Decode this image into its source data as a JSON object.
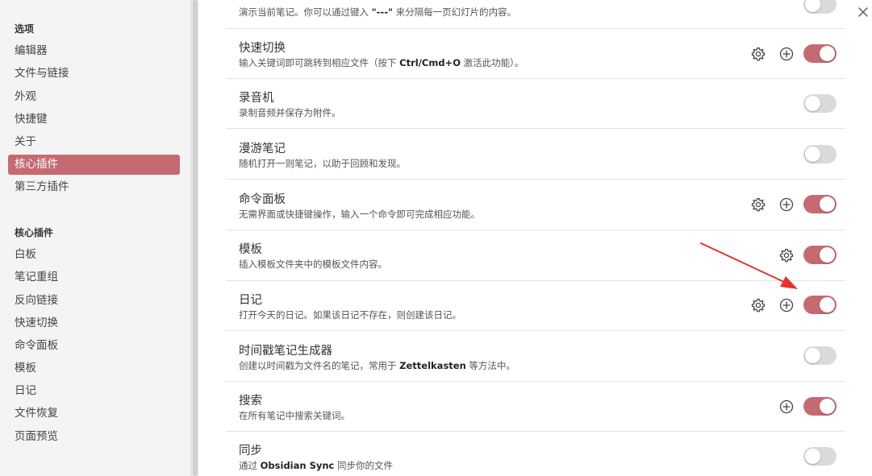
{
  "sidebar": {
    "options_heading": "选项",
    "options": [
      "编辑器",
      "文件与链接",
      "外观",
      "快捷键",
      "关于",
      "核心插件",
      "第三方插件"
    ],
    "active_index": 5,
    "core_heading": "核心插件",
    "core_items": [
      "白板",
      "笔记重组",
      "反向链接",
      "快速切换",
      "命令面板",
      "模板",
      "日记",
      "文件恢复",
      "页面预览"
    ]
  },
  "plugins": {
    "slides": {
      "desc_prefix": "演示当前笔记。你可以通过键入 ",
      "desc_bold": "\"---\"",
      "desc_suffix": " 来分隔每一页幻灯片的内容。",
      "enabled": false
    },
    "switcher": {
      "name": "快速切换",
      "desc_prefix": "输入关键词即可跳转到相应文件（按下 ",
      "desc_bold": "Ctrl/Cmd+O",
      "desc_suffix": " 激活此功能）。",
      "enabled": true
    },
    "recorder": {
      "name": "录音机",
      "desc": "录制音频并保存为附件。",
      "enabled": false
    },
    "random": {
      "name": "漫游笔记",
      "desc": "随机打开一则笔记，以助于回顾和发现。",
      "enabled": false
    },
    "palette": {
      "name": "命令面板",
      "desc": "无需界面或快捷键操作，输入一个命令即可完成相应功能。",
      "enabled": true
    },
    "templates": {
      "name": "模板",
      "desc": "插入模板文件夹中的模板文件内容。",
      "enabled": true
    },
    "daily": {
      "name": "日记",
      "desc": "打开今天的日记。如果该日记不存在，则创建该日记。",
      "enabled": true
    },
    "zk": {
      "name": "时间戳笔记生成器",
      "desc_prefix": "创建以时间戳为文件名的笔记，常用于 ",
      "desc_bold": "Zettelkasten",
      "desc_suffix": " 等方法中。",
      "enabled": false
    },
    "search": {
      "name": "搜索",
      "desc": "在所有笔记中搜索关键词。",
      "enabled": true
    },
    "sync": {
      "name": "同步",
      "desc_prefix": "通过 ",
      "desc_bold": "Obsidian Sync",
      "desc_suffix": " 同步你的文件",
      "enabled": false
    }
  },
  "icons": {
    "gear": "gear-icon",
    "plus": "plus-circle-icon",
    "close": "close-icon",
    "annotation_arrow": "red-arrow"
  },
  "colors": {
    "accent": "#c66a72",
    "toggle_off": "#dadada",
    "arrow": "#e8312a",
    "sidebar_bg": "#f4f4f4"
  }
}
